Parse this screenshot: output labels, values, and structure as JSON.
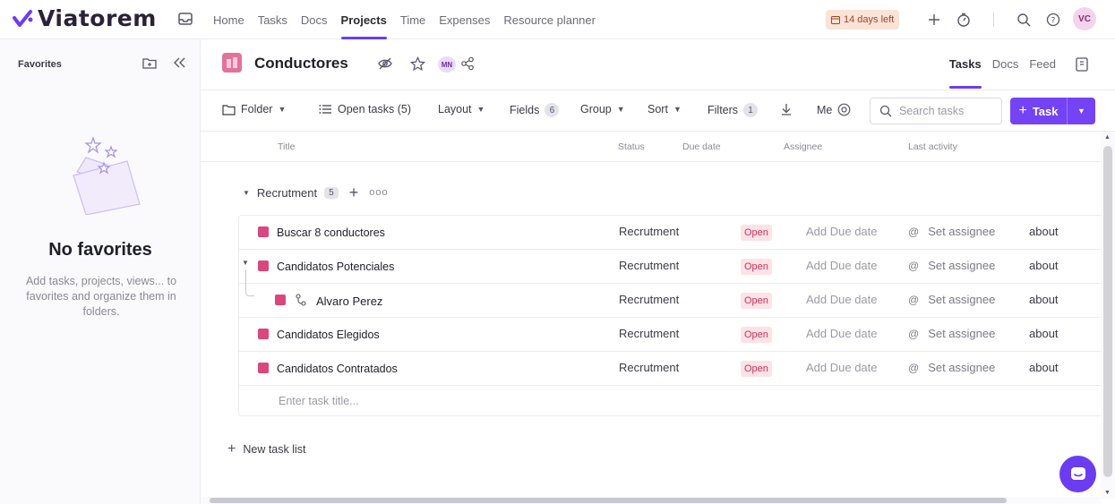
{
  "app": {
    "name": "Viatorem",
    "brand_color": "#6c3df4",
    "trial_badge": "14 days left",
    "user_initials": "VC"
  },
  "topnav": {
    "items": [
      {
        "label": "Home",
        "active": false
      },
      {
        "label": "Tasks",
        "active": false
      },
      {
        "label": "Docs",
        "active": false
      },
      {
        "label": "Projects",
        "active": true
      },
      {
        "label": "Time",
        "active": false
      },
      {
        "label": "Expenses",
        "active": false
      },
      {
        "label": "Resource planner",
        "active": false
      }
    ]
  },
  "sidebar": {
    "title": "Favorites",
    "empty_title": "No favorites",
    "empty_desc": "Add tasks, projects, views... to favorites and organize them in folders."
  },
  "project": {
    "name": "Conductores",
    "member_initials": "MN",
    "tabs": [
      {
        "label": "Tasks",
        "active": true
      },
      {
        "label": "Docs",
        "active": false
      },
      {
        "label": "Feed",
        "active": false
      }
    ]
  },
  "toolbar": {
    "folder": "Folder",
    "open_tasks": "Open tasks (5)",
    "layout": "Layout",
    "fields": "Fields",
    "fields_count": "6",
    "group": "Group",
    "sort": "Sort",
    "filters": "Filters",
    "filters_count": "1",
    "me": "Me",
    "search_placeholder": "Search tasks",
    "add_task": "Task"
  },
  "columns": {
    "title": "Title",
    "status": "Status",
    "due_date": "Due date",
    "assignee": "Assignee",
    "last_activity": "Last activity"
  },
  "group": {
    "name": "Recrutment",
    "count": "5"
  },
  "tasks": [
    {
      "name": "Buscar 8 conductores",
      "status": "Recrutment",
      "state": "Open",
      "due": "Add Due date",
      "assignee": "Set assignee",
      "activity": "about"
    },
    {
      "name": "Candidatos Potenciales",
      "status": "Recrutment",
      "state": "Open",
      "due": "Add Due date",
      "assignee": "Set assignee",
      "activity": "about"
    },
    {
      "name": "Alvaro Perez",
      "status": "Recrutment",
      "state": "Open",
      "due": "Add Due date",
      "assignee": "Set assignee",
      "activity": "about"
    },
    {
      "name": "Candidatos Elegidos",
      "status": "Recrutment",
      "state": "Open",
      "due": "Add Due date",
      "assignee": "Set assignee",
      "activity": "about"
    },
    {
      "name": "Candidatos Contratados",
      "status": "Recrutment",
      "state": "Open",
      "due": "Add Due date",
      "assignee": "Set assignee",
      "activity": "about"
    }
  ],
  "enter_task_placeholder": "Enter task title...",
  "new_task_list": "New task list"
}
